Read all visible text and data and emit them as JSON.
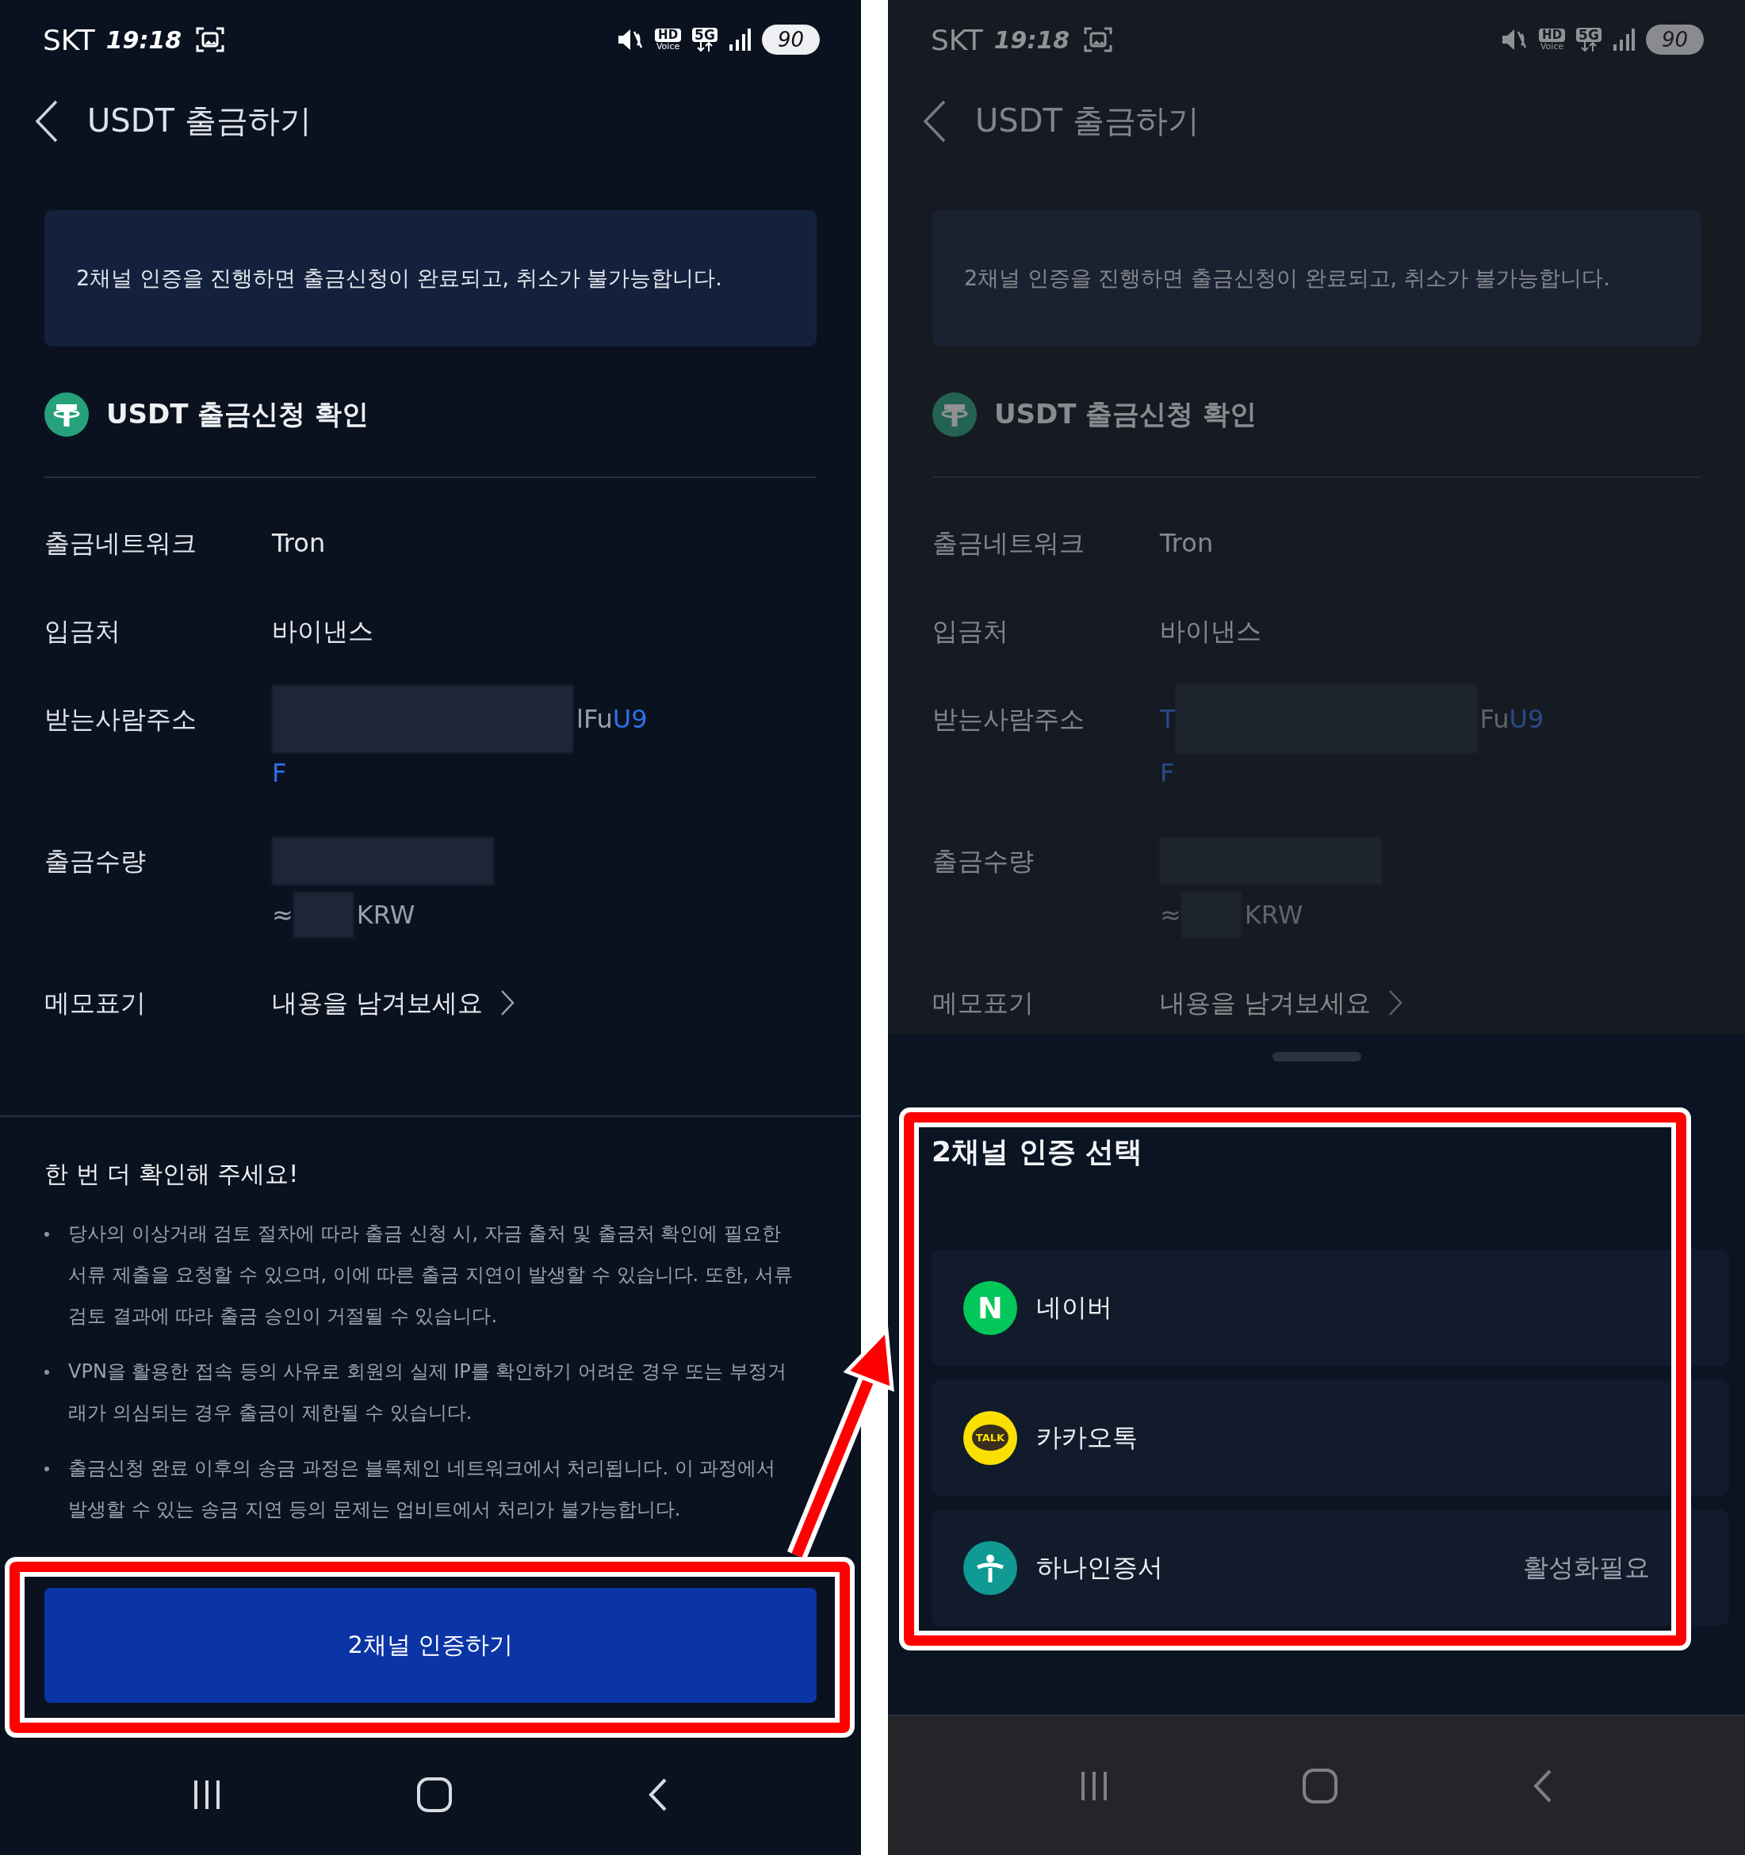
{
  "screens": [
    {
      "dimmed": false,
      "status_bar": {
        "carrier": "SKT",
        "time": "19:18",
        "hd_label": "HD",
        "voice_label": "Voice",
        "network": "5G",
        "battery": "90"
      },
      "header": {
        "title": "USDT 출금하기"
      },
      "notice": "2채널 인증을 진행하면 출금신청이 완료되고, 취소가 불가능합니다.",
      "section_title": "USDT 출금신청 확인",
      "details": [
        {
          "kind": "text",
          "label": "출금네트워크",
          "value": "Tron"
        },
        {
          "kind": "text",
          "label": "입금처",
          "value": "바이낸스"
        },
        {
          "kind": "segments",
          "label": "받는사람주소",
          "lines": [
            [
              {
                "kind": "redacted"
              },
              {
                "kind": "text",
                "text": "lFu",
                "highlight": false
              },
              {
                "kind": "text",
                "text": "U9",
                "highlight": true
              }
            ],
            [
              {
                "kind": "text",
                "text": "F",
                "highlight": true
              }
            ]
          ]
        },
        {
          "kind": "segments",
          "label": "출금수량",
          "lines": [
            [
              {
                "kind": "redacted"
              }
            ],
            [
              {
                "kind": "text",
                "text": "≈",
                "highlight": false
              },
              {
                "kind": "redacted"
              },
              {
                "kind": "text",
                "text": "KRW",
                "highlight": false
              }
            ]
          ]
        },
        {
          "kind": "link",
          "label": "메모표기",
          "value": "내용을 남겨보세요"
        }
      ],
      "caution": {
        "title": "한 번 더 확인해 주세요!",
        "bullets": [
          "당사의 이상거래 검토 절차에 따라 출금 신청 시, 자금 출처 및 출금처 확인에 필요한 서류 제출을 요청할 수 있으며, 이에 따른 출금 지연이 발생할 수 있습니다. 또한, 서류 검토 결과에 따라 출금 승인이 거절될 수 있습니다.",
          "VPN을 활용한 접속 등의 사유로 회원의 실제 IP를 확인하기 어려운 경우 또는 부정거래가 의심되는 경우 출금이 제한될 수 있습니다.",
          "출금신청 완료 이후의 송금 과정은 블록체인 네트워크에서 처리됩니다. 이 과정에서 발생할 수 있는 송금 지연 등의 문제는 업비트에서 처리가 불가능합니다."
        ]
      },
      "primary_button": "2채널 인증하기"
    },
    {
      "dimmed": true,
      "status_bar": {
        "carrier": "SKT",
        "time": "19:18",
        "hd_label": "HD",
        "voice_label": "Voice",
        "network": "5G",
        "battery": "90"
      },
      "header": {
        "title": "USDT 출금하기"
      },
      "notice": "2채널 인증을 진행하면 출금신청이 완료되고, 취소가 불가능합니다.",
      "section_title": "USDT 출금신청 확인",
      "details": [
        {
          "kind": "text",
          "label": "출금네트워크",
          "value": "Tron"
        },
        {
          "kind": "text",
          "label": "입금처",
          "value": "바이낸스"
        },
        {
          "kind": "segments",
          "label": "받는사람주소",
          "lines": [
            [
              {
                "kind": "text",
                "text": "T",
                "highlight": true
              },
              {
                "kind": "redacted"
              },
              {
                "kind": "text",
                "text": "Fu",
                "highlight": false
              },
              {
                "kind": "text",
                "text": "U9",
                "highlight": true
              }
            ],
            [
              {
                "kind": "text",
                "text": "F",
                "highlight": true
              }
            ]
          ]
        },
        {
          "kind": "segments",
          "label": "출금수량",
          "lines": [
            [
              {
                "kind": "redacted"
              }
            ],
            [
              {
                "kind": "text",
                "text": "≈",
                "highlight": false
              },
              {
                "kind": "redacted"
              },
              {
                "kind": "text",
                "text": "KRW",
                "highlight": false
              }
            ]
          ]
        },
        {
          "kind": "link",
          "label": "메모표기",
          "value": "내용을 남겨보세요"
        }
      ],
      "sheet": {
        "title": "2채널 인증 선택",
        "options": [
          {
            "kind": "naver",
            "icon_text": "N",
            "label": "네이버"
          },
          {
            "kind": "kakao",
            "icon_text": "TALK",
            "label": "카카오톡"
          },
          {
            "kind": "hana",
            "label": "하나인증서",
            "status": "활성화필요"
          }
        ]
      }
    }
  ]
}
